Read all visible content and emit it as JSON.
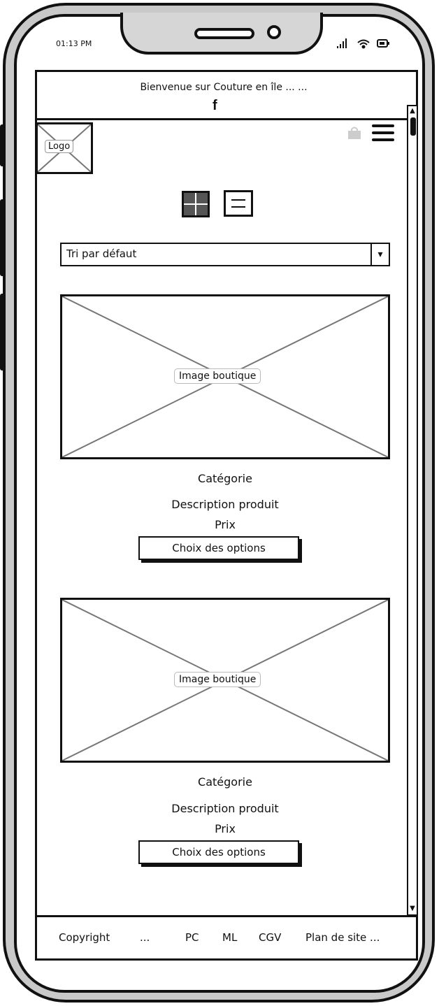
{
  "status": {
    "time": "01:13 PM"
  },
  "header": {
    "welcome": "Bienvenue sur Couture en île ...      ...",
    "facebook_glyph": "f"
  },
  "logo": {
    "label": "Logo"
  },
  "icons": {
    "bag": "shopping-bag-icon",
    "menu": "hamburger-menu-icon",
    "grid_view": "grid-view-icon",
    "list_view": "list-view-icon",
    "facebook": "facebook-icon"
  },
  "sort": {
    "selected": "Tri par défaut",
    "arrow": "▾"
  },
  "products": [
    {
      "image_label": "Image boutique",
      "category": "Catégorie",
      "description": "Description produit",
      "price": "Prix",
      "button": "Choix des options"
    },
    {
      "image_label": "Image boutique",
      "category": "Catégorie",
      "description": "Description produit",
      "price": "Prix",
      "button": "Choix des options"
    }
  ],
  "footer": {
    "copyright": "Copyright",
    "ellipsis": "...",
    "pc": "PC",
    "ml": "ML",
    "cgv": "CGV",
    "sitemap": "Plan de site ..."
  },
  "scroll": {
    "up": "▲",
    "down": "▼"
  }
}
